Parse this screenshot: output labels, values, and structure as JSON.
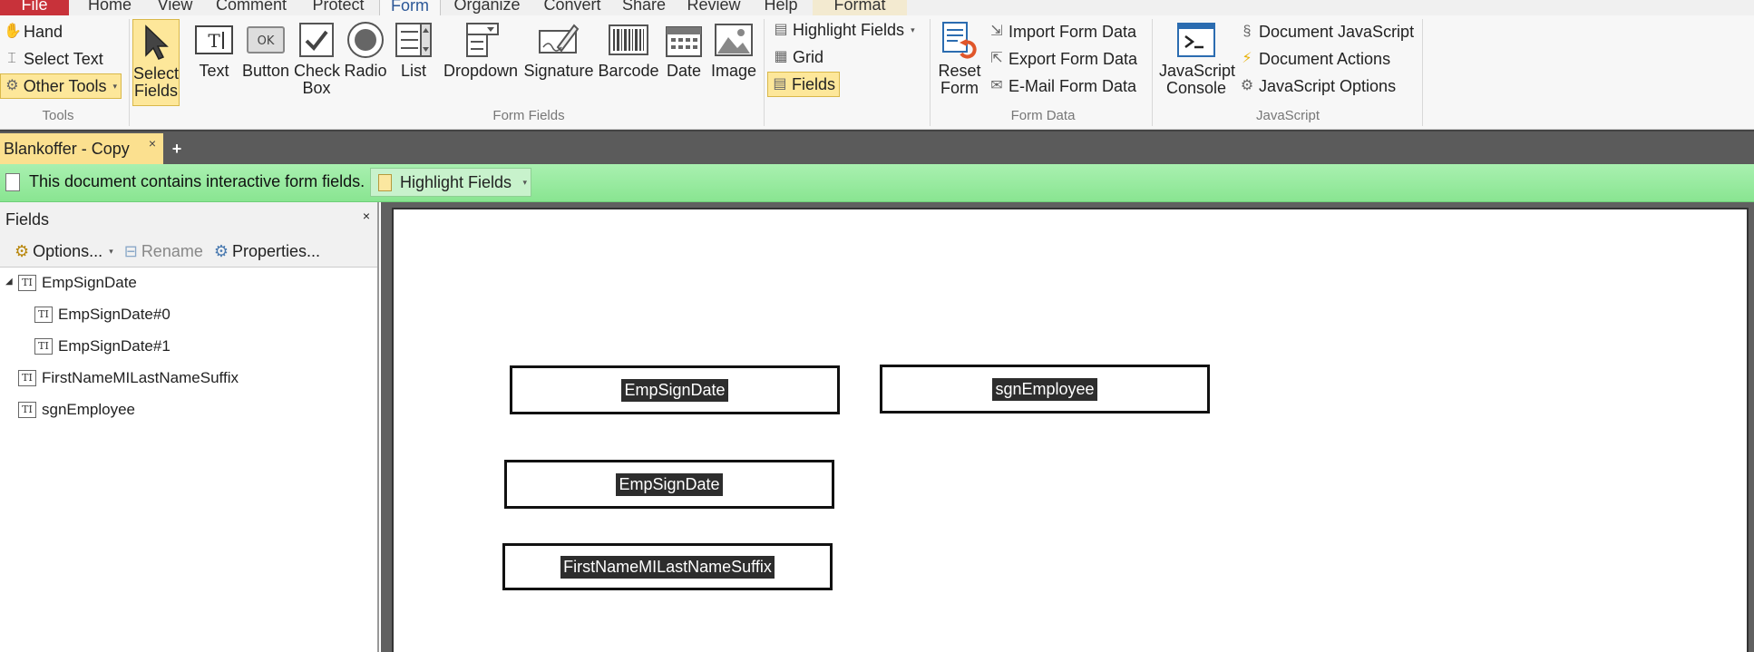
{
  "menu": {
    "tabs": [
      "File",
      "Home",
      "View",
      "Comment",
      "Protect",
      "Form",
      "Organize",
      "Convert",
      "Share",
      "Review",
      "Help",
      "Format"
    ],
    "active": "Form"
  },
  "ribbon": {
    "tools": {
      "hand": "Hand",
      "select_text": "Select Text",
      "other_tools": "Other Tools",
      "group": "Tools"
    },
    "form_fields": {
      "select_fields": "Select Fields",
      "text": "Text",
      "button": "Button",
      "check_box": "Check Box",
      "radio": "Radio",
      "list": "List",
      "dropdown": "Dropdown",
      "signature": "Signature",
      "barcode": "Barcode",
      "date": "Date",
      "image": "Image",
      "group": "Form Fields",
      "highlight_fields": "Highlight Fields",
      "grid": "Grid",
      "fields": "Fields"
    },
    "form_data": {
      "reset_form": "Reset Form",
      "import": "Import Form Data",
      "export": "Export Form Data",
      "email": "E-Mail Form Data",
      "group": "Form Data"
    },
    "javascript": {
      "console": "JavaScript Console",
      "doc_js": "Document JavaScript",
      "doc_actions": "Document Actions",
      "js_options": "JavaScript Options",
      "group": "JavaScript"
    }
  },
  "document_tab": {
    "title": "Blankoffer - Copy",
    "close": "×",
    "add": "+"
  },
  "notice": {
    "text": "This document contains interactive form fields.",
    "button": "Highlight Fields"
  },
  "fields_panel": {
    "title": "Fields",
    "close": "×",
    "options": "Options...",
    "rename": "Rename",
    "properties": "Properties...",
    "tree": [
      {
        "label": "EmpSignDate",
        "level": 0,
        "expanded": true
      },
      {
        "label": "EmpSignDate#0",
        "level": 1
      },
      {
        "label": "EmpSignDate#1",
        "level": 1
      },
      {
        "label": "FirstNameMILastNameSuffix",
        "level": 0
      },
      {
        "label": "sgnEmployee",
        "level": 0
      }
    ]
  },
  "page_fields": [
    "EmpSignDate",
    "sgnEmployee",
    "EmpSignDate",
    "FirstNameMILastNameSuffix"
  ]
}
